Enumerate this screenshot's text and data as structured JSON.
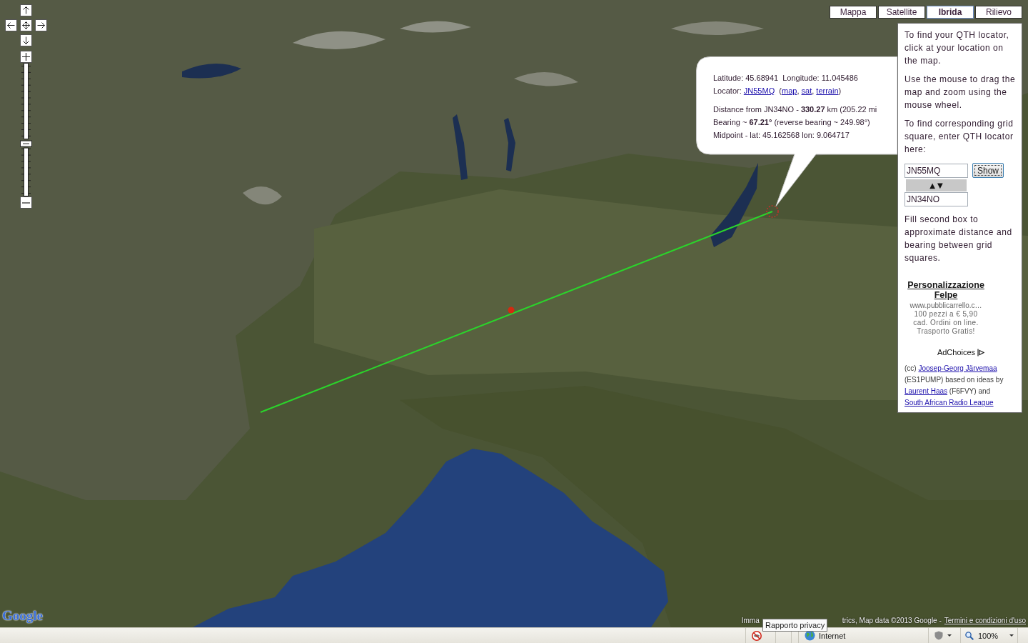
{
  "map": {
    "type_buttons": [
      {
        "label": "Mappa",
        "selected": false
      },
      {
        "label": "Satellite",
        "selected": false
      },
      {
        "label": "Ibrida",
        "selected": true
      },
      {
        "label": "Rilievo",
        "selected": false
      }
    ],
    "zoom_slider": {
      "level": 0.39
    },
    "logo": "Google",
    "copyright": {
      "visible_start": "Imma",
      "visible_rest": "trics, Map data ©2013 Google -",
      "terms_link": "Termini e condizioni d'uso"
    }
  },
  "info_bubble": {
    "coordinates": "Latitude: 45.68941  Longitude: 11.045486",
    "locator": [
      {
        "kind": "text",
        "text": "Locator: "
      },
      {
        "kind": "link",
        "text": "JN55MQ"
      },
      {
        "kind": "text",
        "text": "  ("
      },
      {
        "kind": "link",
        "text": "map"
      },
      {
        "kind": "text",
        "text": ", "
      },
      {
        "kind": "link",
        "text": "sat"
      },
      {
        "kind": "text",
        "text": ", "
      },
      {
        "kind": "link",
        "text": "terrain"
      },
      {
        "kind": "text",
        "text": ")"
      }
    ],
    "distance": "Distance from JN34NO - **330.27** km (205.22 mi",
    "bearing": "Bearing ~ **67.21°** (reverse bearing ~ 249.98°)",
    "midpoint": "Midpoint - lat: 45.162568 lon: 9.064717"
  },
  "side_panel": {
    "intro": [
      "To find your QTH locator, click at your location on the map.",
      "Use the mouse to drag the map and zoom using the mouse wheel.",
      "To find corresponding grid square, enter QTH locator here:"
    ],
    "locator_field": {
      "value": "JN55MQ"
    },
    "show_button": "Show",
    "swap_button": "▲ ▼",
    "second_field": {
      "value": "JN34NO"
    },
    "note": "Fill second box to approximate distance and bearing between grid squares.",
    "ad": {
      "title": "Personalizzazione Felpe",
      "url": "www.pubblicarrello.c…",
      "text": "100 pezzi a € 5,90 cad. Ordini on line. Trasporto Gratis!",
      "adchoices": "AdChoices"
    },
    "credits": [
      {
        "kind": "text",
        "text": "(cc) "
      },
      {
        "kind": "link",
        "text": "Joosep-Georg Järvemaa"
      },
      {
        "kind": "text",
        "text": " (ES1PUMP) based on ideas by "
      },
      {
        "kind": "link",
        "text": "Laurent Haas"
      },
      {
        "kind": "text",
        "text": " (F6FVY) and "
      },
      {
        "kind": "link",
        "text": "South African Radio League"
      }
    ]
  },
  "status_bar": {
    "tooltip": "Rapporto privacy",
    "zone": "Internet",
    "zoom": "100%"
  }
}
